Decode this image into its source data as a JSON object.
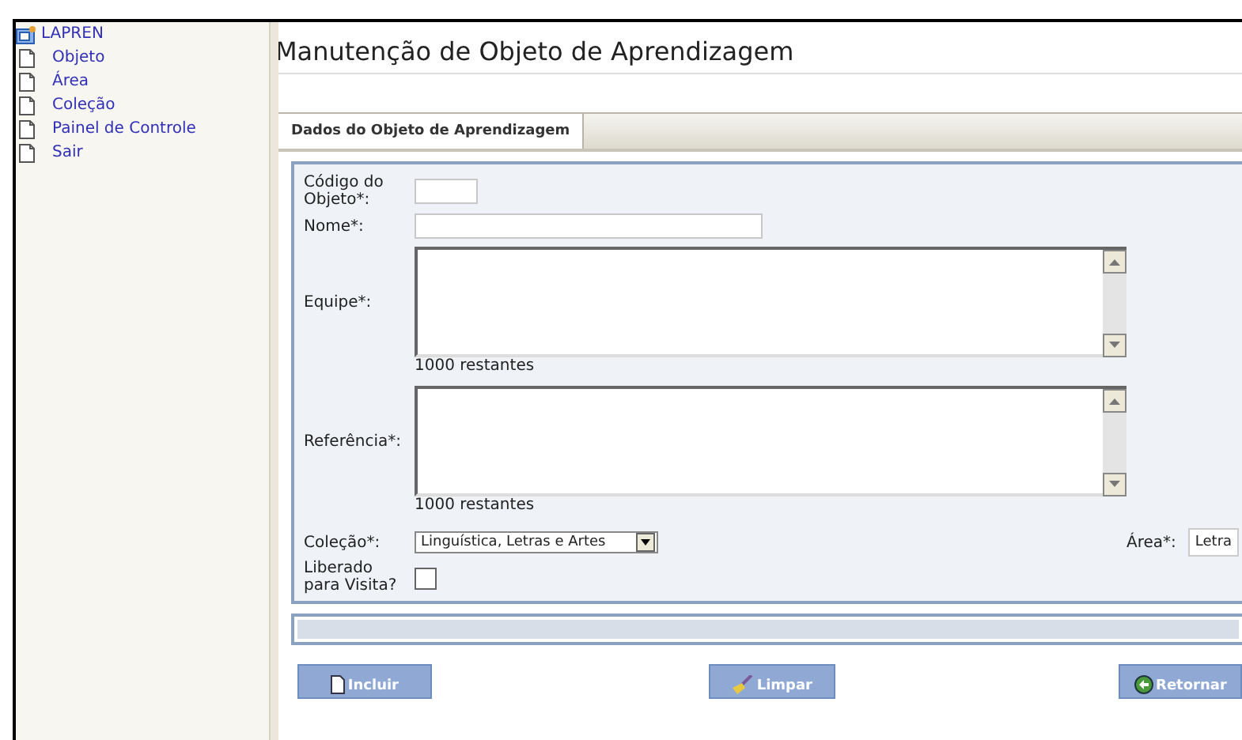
{
  "sidebar": {
    "title": "LAPREN",
    "items": [
      {
        "label": "Objeto"
      },
      {
        "label": "Área"
      },
      {
        "label": "Coleção"
      },
      {
        "label": "Painel de Controle"
      },
      {
        "label": "Sair"
      }
    ]
  },
  "page_title": "Manutenção de Objeto de Aprendizagem",
  "tabs": [
    {
      "label": "Dados do Objeto de Aprendizagem",
      "selected": true
    }
  ],
  "form": {
    "fields": [
      {
        "kind": "short_input",
        "label": "Código do Objeto*:"
      },
      {
        "kind": "input",
        "label": "Nome*:"
      },
      {
        "kind": "textarea",
        "label": "Equipe*:",
        "counter": "1000 restantes"
      },
      {
        "kind": "textarea",
        "label": "Referência*:",
        "counter": "1000 restantes"
      },
      {
        "kind": "select_pair",
        "label": "Coleção*:",
        "value": "Linguística, Letras e Artes",
        "label_2": "Área*:",
        "value_2": "Letra"
      },
      {
        "kind": "checkbox",
        "label": "Liberado para Visita?",
        "checked": false
      }
    ]
  },
  "buttons": [
    {
      "kind": "add",
      "label": "Incluir"
    },
    {
      "kind": "clean",
      "label": "Limpar"
    },
    {
      "kind": "back",
      "label": "Retornar"
    }
  ]
}
